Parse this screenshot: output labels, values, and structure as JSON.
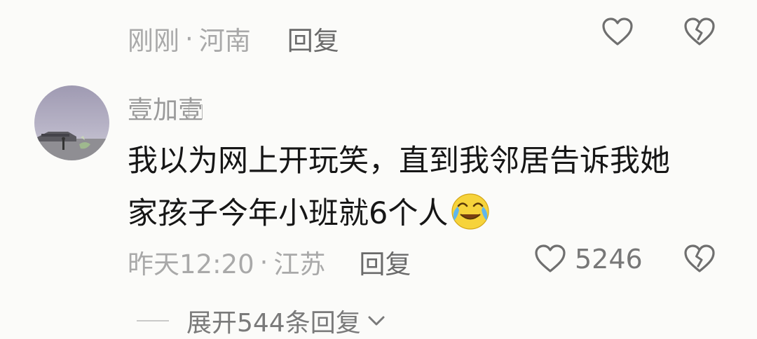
{
  "top_comment": {
    "time": "刚刚",
    "separator": "·",
    "location": "河南",
    "reply_label": "回复"
  },
  "comment": {
    "username": "壹加壹",
    "username_badge": "⃞",
    "text_line1": "我以为网上开玩笑，直到我邻居告诉我她",
    "text_line2": "家孩子今年小班就6个人",
    "emoji": "crying-laughing-emoji",
    "time": "昨天12:20",
    "separator": "·",
    "location": "江苏",
    "reply_label": "回复",
    "like_count": "5246"
  },
  "expand": {
    "label": "展开544条回复"
  },
  "icons": {
    "like": "heart-outline-icon",
    "dislike": "broken-heart-icon",
    "expand": "chevron-down-icon"
  },
  "colors": {
    "background": "#fbfbf9",
    "meta_text": "#a9a9a9",
    "body_text": "#161616",
    "icon_stroke": "#6f6f6f"
  }
}
